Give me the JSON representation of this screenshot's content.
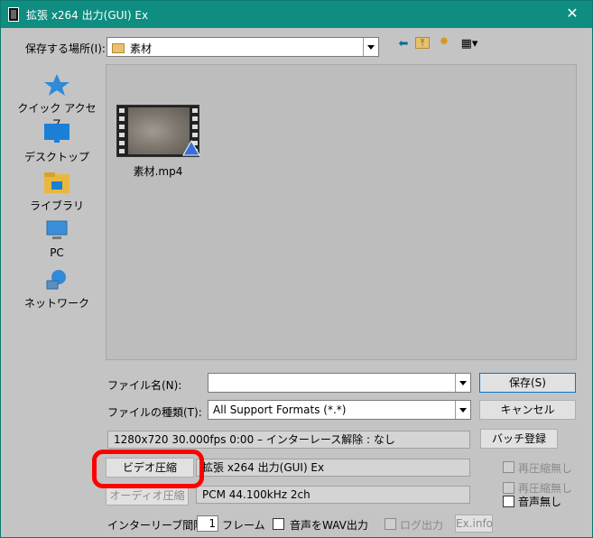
{
  "window": {
    "title": "拡張 x264 出力(GUI) Ex",
    "close_glyph": "✕"
  },
  "location": {
    "label": "保存する場所(I):",
    "value": "素材"
  },
  "toolbar": {
    "back_glyph": "⬅",
    "up_glyph": "⤒",
    "new_folder_glyph": "✸",
    "view_glyph": "▦▾"
  },
  "places": [
    {
      "label": "クイック アクセス",
      "icon": "star-icon"
    },
    {
      "label": "デスクトップ",
      "icon": "desktop-icon"
    },
    {
      "label": "ライブラリ",
      "icon": "library-icon"
    },
    {
      "label": "PC",
      "icon": "pc-icon"
    },
    {
      "label": "ネットワーク",
      "icon": "network-icon"
    }
  ],
  "files": [
    {
      "name": "素材.mp4",
      "icon": "video-file-icon"
    }
  ],
  "filename": {
    "label": "ファイル名(N):",
    "value": ""
  },
  "filetype": {
    "label": "ファイルの種類(T):",
    "value": "All Support Formats (*.*)"
  },
  "buttons": {
    "save": "保存(S)",
    "cancel": "キャンセル",
    "batch": "バッチ登録",
    "video_compress": "ビデオ圧縮",
    "audio_compress": "オーディオ圧縮",
    "exinfo": "Ex.info"
  },
  "info": {
    "video_info": "1280x720  30.000fps  0:00  –  インターレース解除 : なし",
    "video_codec": "拡張 x264 出力(GUI) Ex",
    "audio_codec": "PCM 44.100kHz 2ch"
  },
  "options": {
    "recompress_none_1": "再圧縮無し",
    "recompress_none_2": "再圧縮無し",
    "no_audio": "音声無し",
    "interleave_label": "インターリーブ間隔 :",
    "interleave_value": "1",
    "interleave_unit": "フレーム",
    "audio_wav": "音声をWAV出力",
    "log_output": "ログ出力"
  },
  "colors": {
    "titlebar": "#0e8d80",
    "highlight": "#ff0000"
  }
}
